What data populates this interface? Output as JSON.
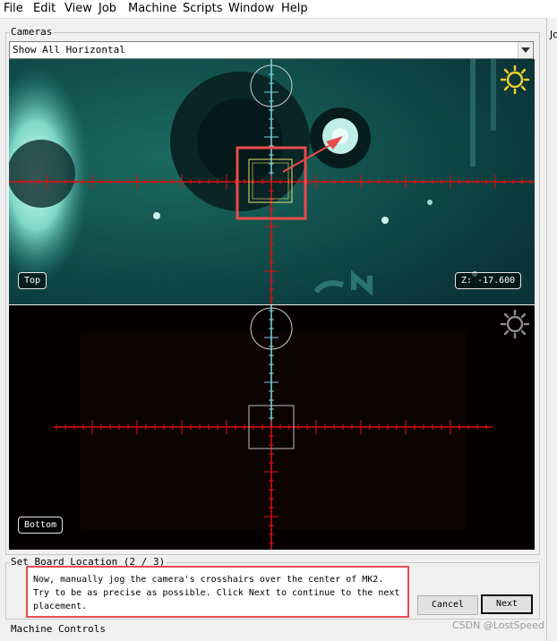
{
  "menu": {
    "items": [
      "File",
      "Edit",
      "View",
      "Job",
      "Machine",
      "Scripts",
      "Window",
      "Help"
    ]
  },
  "cameras": {
    "title": "Cameras",
    "view_select": "Show All Horizontal",
    "top": {
      "label": "Top",
      "z_readout": "Z: -17.600"
    },
    "bottom": {
      "label": "Bottom"
    }
  },
  "set_board_location": {
    "title": "Set Board Location (2 / 3)",
    "instructions": "Now, manually jog the camera's crosshairs over the center of MK2. Try to be as precise as possible. Click Next to continue to the next placement.",
    "cancel_label": "Cancel",
    "next_label": "Next"
  },
  "machine_controls": {
    "title": "Machine Controls"
  },
  "right_panel": {
    "title_fragment": "Jo"
  },
  "watermark": "CSDN @LostSpeed",
  "colors": {
    "annotation_red": "#e74c4c",
    "crosshair_red": "#e01010",
    "crosshair_cyan": "#7fd6e6",
    "reticle_yellow": "#e6e66a"
  }
}
